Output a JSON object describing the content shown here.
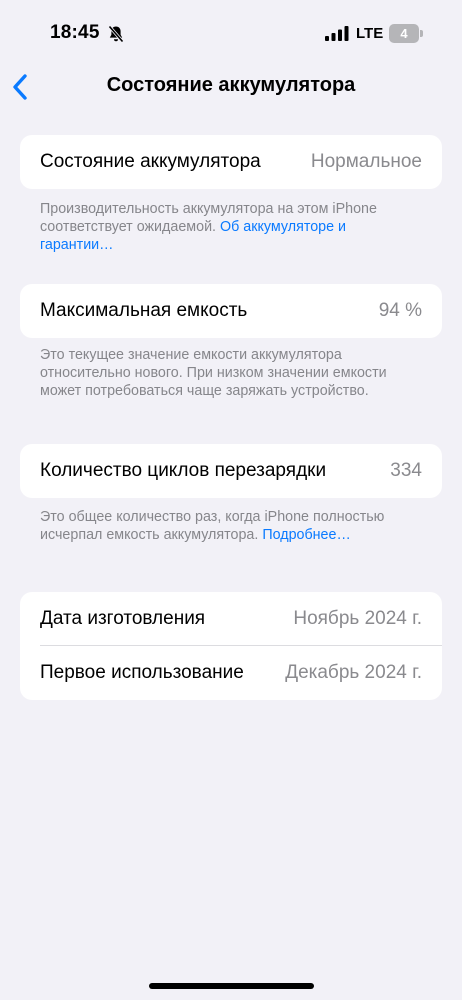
{
  "status_bar": {
    "time": "18:45",
    "network": "LTE",
    "battery_level": "4"
  },
  "nav": {
    "title": "Состояние аккумулятора"
  },
  "battery_health": {
    "label": "Состояние аккумулятора",
    "value": "Нормальное",
    "footnote_text": "Производительность аккумулятора на этом iPhone соответствует ожидаемой.",
    "footnote_link": "Об аккумуляторе и гарантии…"
  },
  "max_capacity": {
    "label": "Максимальная емкость",
    "value": "94 %",
    "footnote_text": "Это текущее значение емкости аккумулятора относительно нового. При низком значении емкости может потребоваться чаще заряжать устройство."
  },
  "cycle_count": {
    "label": "Количество циклов перезарядки",
    "value": "334",
    "footnote_text": "Это общее количество раз, когда iPhone полностью исчерпал емкость аккумулятора.",
    "footnote_link": "Подробнее…"
  },
  "dates": {
    "manufacture_label": "Дата изготовления",
    "manufacture_value": "Ноябрь 2024 г.",
    "first_use_label": "Первое использование",
    "first_use_value": "Декабрь 2024 г."
  }
}
